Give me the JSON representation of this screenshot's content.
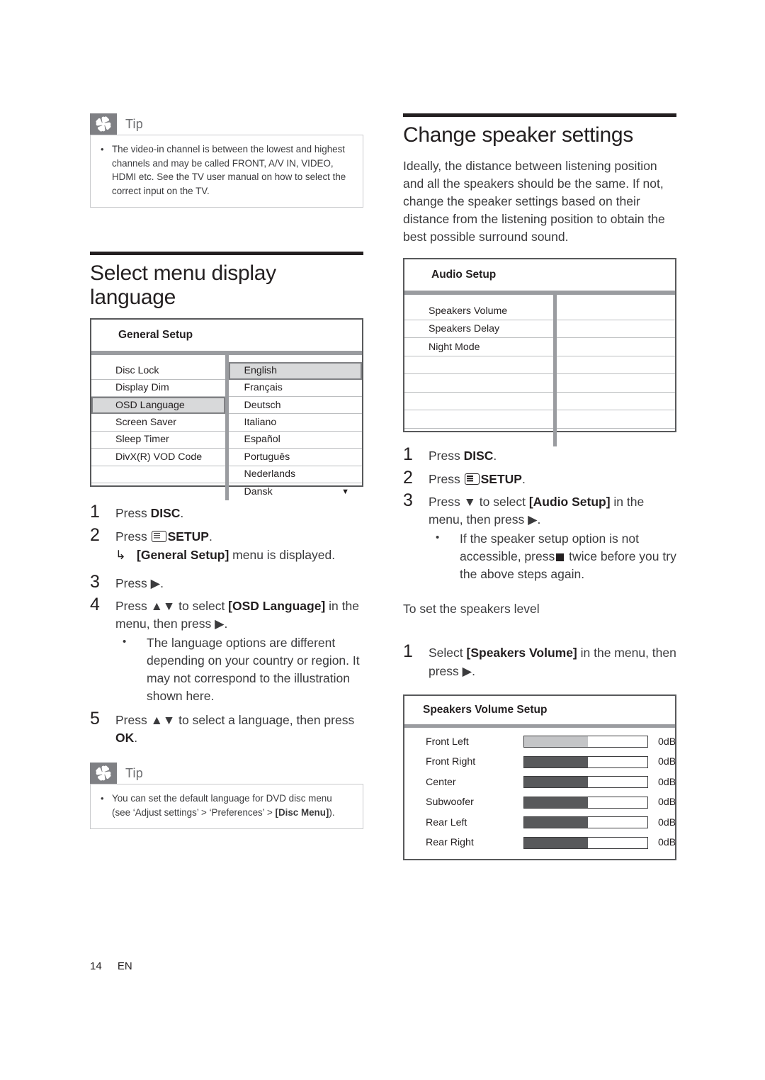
{
  "footer": {
    "page_number": "14",
    "language_code": "EN"
  },
  "left": {
    "tip_top": {
      "label": "Tip",
      "icon": "asterisk-icon",
      "items": [
        "The video-in channel is between the lowest and highest channels and may be called FRONT, A/V IN, VIDEO, HDMI etc. See the TV user manual on how to select the correct input on the TV."
      ]
    },
    "section": {
      "title": "Select menu display language"
    },
    "general_setup": {
      "title": "General Setup",
      "left_items": [
        "Disc Lock",
        "Display Dim",
        "OSD Language",
        "Screen Saver",
        "Sleep Timer",
        "DivX(R) VOD Code",
        "",
        ""
      ],
      "left_selected_index": 2,
      "right_items": [
        "English",
        "Français",
        "Deutsch",
        "Italiano",
        "Español",
        "Português",
        "Nederlands",
        "Dansk"
      ],
      "right_selected_index": 0,
      "scroll_arrow": "▼"
    },
    "steps": [
      {
        "num": "1",
        "text_plain": "Press ",
        "bold": "DISC",
        "tail": "."
      },
      {
        "num": "2",
        "text_plain": "Press ",
        "icon": "setup-menu-icon",
        "bold": "SETUP",
        "tail": ".",
        "arrow_note_bold": "[General Setup]",
        "arrow_note_tail": " menu is displayed.",
        "arrow_glyph": "↳"
      },
      {
        "num": "3",
        "text_plain": "Press ",
        "glyph": "▶",
        "tail": "."
      },
      {
        "num": "4",
        "text_plain": "Press ",
        "glyph": "▲▼",
        "mid": " to select ",
        "bold": "[OSD Language]",
        "tail": " in the menu, then press ▶.",
        "bullets": [
          "The language options are different depending on your country or region. It may not correspond to the illustration shown here."
        ]
      },
      {
        "num": "5",
        "text_plain": "Press ",
        "glyph": "▲▼",
        "mid": " to select a language, then press ",
        "bold2": "OK",
        "tail": "."
      }
    ],
    "tip_bottom": {
      "label": "Tip",
      "icon": "asterisk-icon",
      "item_pre": "You can set the default language for DVD disc menu (see ‘Adjust settings’ > ‘Preferences’ > ",
      "item_bold": "[Disc Menu]",
      "item_post": ")."
    }
  },
  "right": {
    "section": {
      "title": "Change speaker settings"
    },
    "intro": "Ideally, the distance between listening position and all the speakers should be the same. If not, change the speaker settings based on their distance from the listening position to obtain the best possible surround sound.",
    "audio_setup": {
      "title": "Audio Setup",
      "left_items": [
        "Speakers Volume",
        "Speakers Delay",
        "Night Mode",
        "",
        "",
        "",
        "",
        ""
      ],
      "right_items": [
        "",
        "",
        "",
        "",
        "",
        "",
        "",
        ""
      ]
    },
    "steps": [
      {
        "num": "1",
        "text_plain": "Press ",
        "bold": "DISC",
        "tail": "."
      },
      {
        "num": "2",
        "text_plain": "Press ",
        "icon": "setup-menu-icon",
        "bold": "SETUP",
        "tail": "."
      },
      {
        "num": "3",
        "text_plain": "Press ",
        "glyph": "▼",
        "mid": " to select ",
        "bold": "[Audio Setup]",
        "tail": " in the menu, then press ▶.",
        "bullet_pre": "If the speaker setup option is not accessible, press",
        "bullet_icon": "stop-square-icon",
        "bullet_post": " twice before you try the above steps again."
      }
    ],
    "speakers_level_heading": "To set the speakers level",
    "steps2": [
      {
        "num": "1",
        "text_plain": "Select ",
        "bold": "[Speakers Volume]",
        "tail": " in the menu, then press ▶."
      }
    ],
    "speakers_volume_setup": {
      "title": "Speakers Volume Setup",
      "rows": [
        {
          "name": "Front Left",
          "value": "0dB",
          "fill_pct": 52,
          "highlighted": true
        },
        {
          "name": "Front Right",
          "value": "0dB",
          "fill_pct": 52,
          "highlighted": false
        },
        {
          "name": "Center",
          "value": "0dB",
          "fill_pct": 52,
          "highlighted": false
        },
        {
          "name": "Subwoofer",
          "value": "0dB",
          "fill_pct": 52,
          "highlighted": false
        },
        {
          "name": "Rear Left",
          "value": "0dB",
          "fill_pct": 52,
          "highlighted": false
        },
        {
          "name": "Rear Right",
          "value": "0dB",
          "fill_pct": 52,
          "highlighted": false
        }
      ]
    }
  },
  "colors": {
    "text": "#231f20",
    "body_text": "#3b3b3d",
    "tip_icon_bg": "#7f8084",
    "osd_border": "#58595b",
    "osd_divider": "#9a9ca0",
    "osd_selected_bg": "#d8d9da",
    "bar_fill": "#58595b",
    "bar_fill_highlight": "#c4c5c7"
  }
}
